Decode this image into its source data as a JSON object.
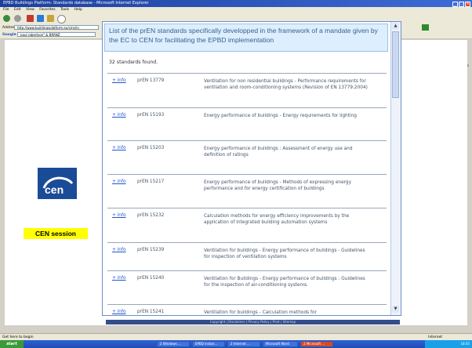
{
  "window": {
    "title": "EPBD Buildings Platform: Standards database - Microsoft Internet Explorer"
  },
  "menu": [
    "File",
    "Edit",
    "View",
    "Favorites",
    "Tools",
    "Help"
  ],
  "address": {
    "label": "Address",
    "value": "http://www.buildingsplatform.eu/cms/in"
  },
  "google": {
    "label": "Google",
    "value": "paul robertson\" & BRANZ"
  },
  "right_tools": {
    "links": "Links",
    "settings": "Settings"
  },
  "slide": {
    "session_label": "CEN session"
  },
  "popup": {
    "title": "List of the prEN standards specifically developped in the framework of a mandate given by the EC to CEN for facilitating the EPBD implementation",
    "count_text": "32 standards found.",
    "rows": [
      {
        "info": "+ info",
        "code": "prEN 13779",
        "desc": "Ventilation for non residential buildings - Performance requirements for ventilation and room-conditioning systems (Revision of EN 13779:2004)"
      },
      {
        "info": "+ info",
        "code": "prEN 15193",
        "desc": "Energy performance of buildings - Energy requirements for lighting"
      },
      {
        "info": "+ info",
        "code": "prEN 15203",
        "desc": "Energy performance of buildings : Assessment of energy use and definition of ratings"
      },
      {
        "info": "+ info",
        "code": "prEN 15217",
        "desc": "Energy performance of buildings - Methods of expressing energy performance and for energy certification of buildings"
      },
      {
        "info": "+ info",
        "code": "prEN 15232",
        "desc": "Calculation methods for energy efficiency improvements by the application of integrated building automation systems"
      },
      {
        "info": "+ info",
        "code": "prEN 15239",
        "desc": "Ventilation for buildings - Energy performance of buildings - Guidelines for inspection of ventilation systems"
      },
      {
        "info": "+ info",
        "code": "prEN 15240",
        "desc": "Ventilation for Buildings - Energy performance of buildings : Guidelines for the inspection of air-conditioning systems."
      },
      {
        "info": "+ info",
        "code": "prEN 15241",
        "desc": "Ventilation for buildings - Calculation methods for"
      }
    ],
    "footer": "Copyright | Disclaimer | Privacy Policy | Print | Sitemap"
  },
  "status": {
    "left": "Get here to begin",
    "right": "Internet"
  },
  "taskbar": {
    "start": "start",
    "apps": [
      "2 Windows ...",
      "EPBD Instan...",
      "2 Internet ...",
      "Microsoft Word",
      "2 Microsoft ..."
    ],
    "clock": "18:05"
  }
}
